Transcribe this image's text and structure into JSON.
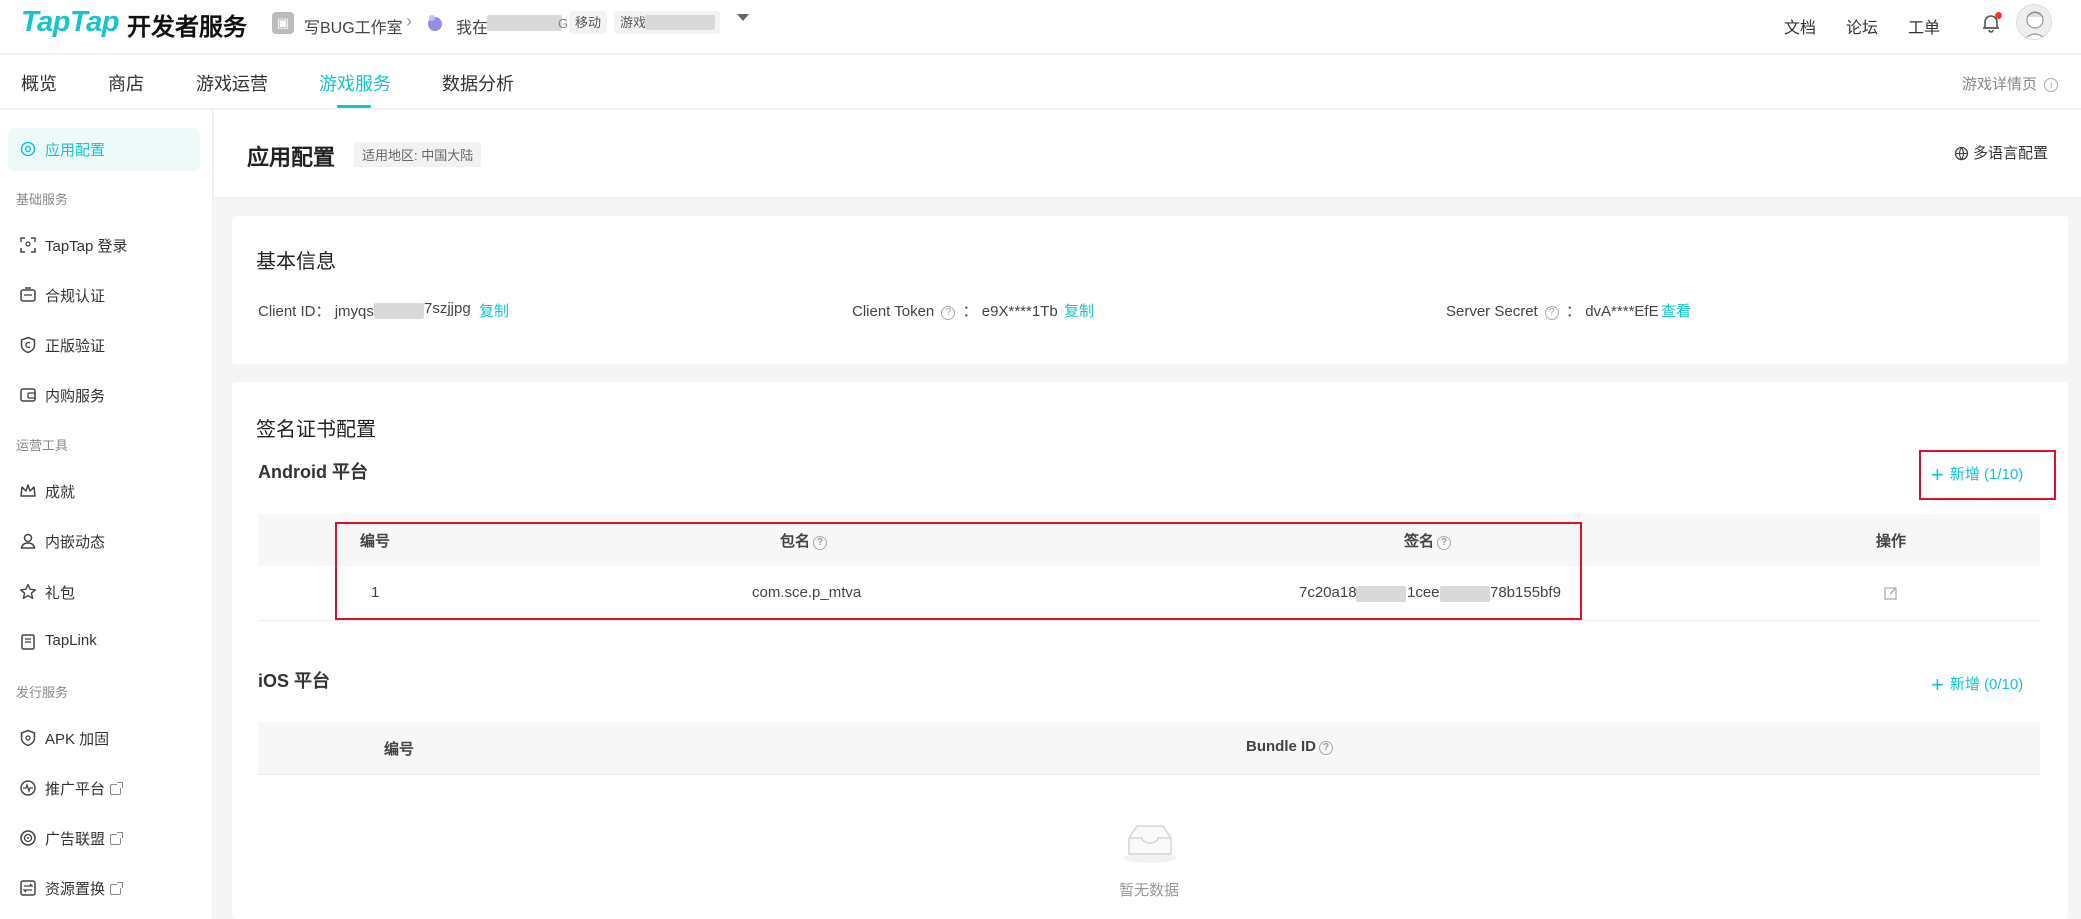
{
  "topbar": {
    "logo": "TapTap",
    "logo_sub": "开发者服务",
    "studio": "写BUG工作室",
    "app_prefix": "我在",
    "app_suffix": "G",
    "platform_tag": "移动",
    "game_tag": "游戏",
    "links": [
      "文档",
      "论坛",
      "工单"
    ]
  },
  "nav": {
    "tabs": [
      "概览",
      "商店",
      "游戏运营",
      "游戏服务",
      "数据分析"
    ],
    "active": "游戏服务",
    "detail_link": "游戏详情页"
  },
  "sidebar": {
    "items": [
      {
        "label": "应用配置",
        "icon": "gear-icon",
        "active": true
      },
      {
        "group": "基础服务"
      },
      {
        "label": "TapTap 登录",
        "icon": "scan-icon"
      },
      {
        "label": "合规认证",
        "icon": "id-card-icon"
      },
      {
        "label": "正版验证",
        "icon": "shield-icon"
      },
      {
        "label": "内购服务",
        "icon": "wallet-icon"
      },
      {
        "group": "运营工具"
      },
      {
        "label": "成就",
        "icon": "crown-icon"
      },
      {
        "label": "内嵌动态",
        "icon": "user-icon"
      },
      {
        "label": "礼包",
        "icon": "star-icon"
      },
      {
        "label": "TapLink",
        "icon": "document-icon"
      },
      {
        "group": "发行服务"
      },
      {
        "label": "APK 加固",
        "icon": "shield-lock-icon"
      },
      {
        "label": "推广平台",
        "icon": "globe-icon",
        "external": true
      },
      {
        "label": "广告联盟",
        "icon": "ad-icon",
        "external": true
      },
      {
        "label": "资源置换",
        "icon": "exchange-icon",
        "external": true
      }
    ]
  },
  "page": {
    "title": "应用配置",
    "region": "适用地区: 中国大陆",
    "lang_config": "多语言配置"
  },
  "basic": {
    "title": "基本信息",
    "client_id_label": "Client ID：",
    "client_id_a": "jmyqs",
    "client_id_b": "7szjjpg",
    "copy": "复制",
    "client_token_label": "Client Token",
    "client_token_value": "：  e9X****1Tb",
    "server_secret_label": "Server Secret",
    "server_secret_value": "：  dvA****EfE",
    "view": "查看"
  },
  "cert": {
    "title": "签名证书配置",
    "android": {
      "platform": "Android 平台",
      "add": "新增 (1/10)",
      "headers": [
        "编号",
        "包名",
        "签名",
        "操作"
      ],
      "rows": [
        {
          "no": "1",
          "package": "com.sce.p_mtva",
          "sig_a": "7c20a18",
          "sig_b": "1cee",
          "sig_c": "78b155bf9"
        }
      ]
    },
    "ios": {
      "platform": "iOS 平台",
      "add": "新增 (0/10)",
      "headers": [
        "编号",
        "Bundle ID"
      ],
      "empty": "暂无数据"
    }
  },
  "colors": {
    "accent": "#15c5ce",
    "highlight": "#e0102a"
  }
}
